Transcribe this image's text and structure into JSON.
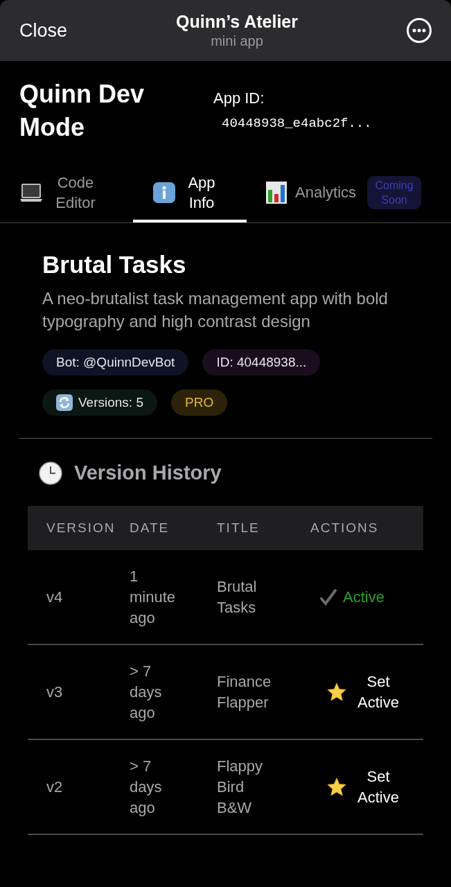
{
  "top_bar": {
    "close": "Close",
    "title": "Quinn’s Atelier",
    "subtitle": "mini app"
  },
  "header": {
    "title": "Quinn Dev Mode",
    "app_id_label": "App ID:",
    "app_id": "40448938_e4abc2f..."
  },
  "tabs": [
    {
      "kind": "laptop",
      "label": "Code Editor",
      "selected": false
    },
    {
      "kind": "info",
      "label": "App Info",
      "selected": true
    },
    {
      "kind": "chart",
      "label": "Analytics",
      "selected": false,
      "badge": "Coming Soon"
    }
  ],
  "app": {
    "name": "Brutal Tasks",
    "description": "A neo-brutalist task management app with bold typography and high contrast design",
    "tags": [
      {
        "kind": "bot",
        "label": "Bot: @QuinnDevBot"
      },
      {
        "kind": "id",
        "label": "ID: 40448938..."
      },
      {
        "kind": "versions",
        "label": "Versions: 5"
      },
      {
        "kind": "pro",
        "label": "PRO"
      }
    ]
  },
  "version_history": {
    "title": "Version History",
    "columns": [
      "VERSION",
      "DATE",
      "TITLE",
      "ACTIONS"
    ],
    "rows": [
      {
        "version": "v4",
        "date": "1 minute ago",
        "title": "Brutal Tasks",
        "active": true,
        "action": "Active"
      },
      {
        "version": "v3",
        "date": "> 7 days ago",
        "title": "Finance Flapper",
        "active": false,
        "action": "Set Active"
      },
      {
        "version": "v2",
        "date": "> 7 days ago",
        "title": "Flappy Bird B&W",
        "active": false,
        "action": "Set Active"
      }
    ]
  }
}
